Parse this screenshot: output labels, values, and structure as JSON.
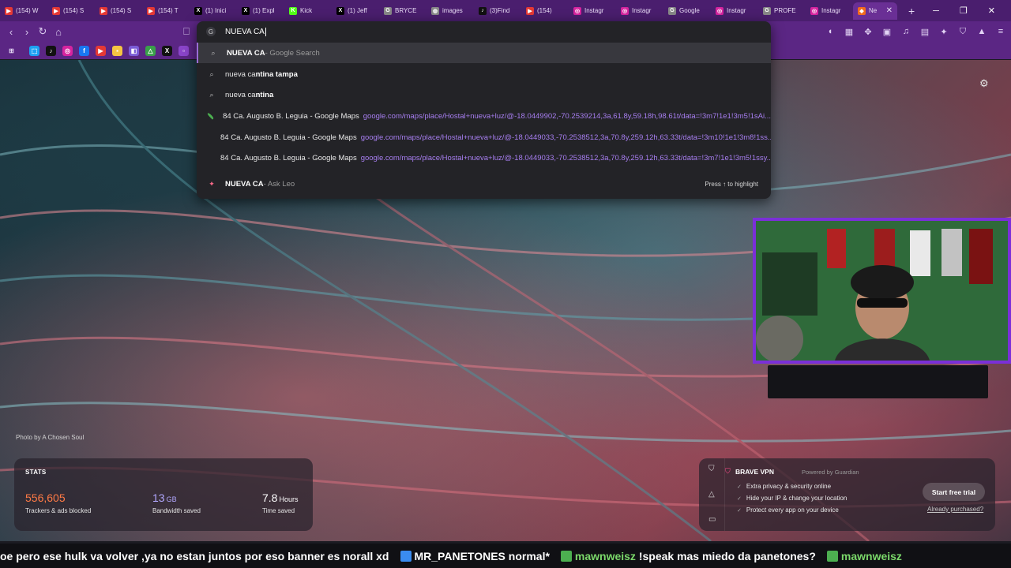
{
  "tabs": [
    {
      "label": "(154) W",
      "icon": "youtube-icon",
      "color": "#e53935"
    },
    {
      "label": "(154) S",
      "icon": "youtube-icon",
      "color": "#e53935"
    },
    {
      "label": "(154) S",
      "icon": "youtube-icon",
      "color": "#e53935"
    },
    {
      "label": "(154) T",
      "icon": "youtube-icon",
      "color": "#e53935"
    },
    {
      "label": "(1) Inici",
      "icon": "x-icon",
      "color": "#000000"
    },
    {
      "label": "(1) Expl",
      "icon": "x-icon",
      "color": "#000000"
    },
    {
      "label": "Kick",
      "icon": "kick-icon",
      "color": "#53fc18"
    },
    {
      "label": "(1) Jeff",
      "icon": "x-icon",
      "color": "#000000"
    },
    {
      "label": "BRYCE",
      "icon": "google-icon",
      "color": "#888888"
    },
    {
      "label": "images",
      "icon": "web-icon",
      "color": "#888888"
    },
    {
      "label": "(3)Find",
      "icon": "tiktok-icon",
      "color": "#111111"
    },
    {
      "label": "(154)",
      "icon": "youtube-icon",
      "color": "#e53935"
    },
    {
      "label": "Instagr",
      "icon": "instagram-icon",
      "color": "#d6249f"
    },
    {
      "label": "Instagr",
      "icon": "instagram-icon",
      "color": "#d6249f"
    },
    {
      "label": "Google",
      "icon": "google-icon",
      "color": "#888888"
    },
    {
      "label": "Instagr",
      "icon": "instagram-icon",
      "color": "#d6249f"
    },
    {
      "label": "PROFE",
      "icon": "google-icon",
      "color": "#888888"
    },
    {
      "label": "Instagr",
      "icon": "instagram-icon",
      "color": "#d6249f"
    }
  ],
  "active_tab": {
    "label": "Ne",
    "icon": "brave-icon"
  },
  "omnibox": {
    "query": "NUEVA CA",
    "suggestions": [
      {
        "type": "search",
        "bold": "NUEVA CA",
        "suffix": " - Google Search"
      },
      {
        "type": "search",
        "prefix": "nueva ca",
        "bold": "ntina tampa"
      },
      {
        "type": "search",
        "prefix": "nueva ca",
        "bold": "ntina"
      },
      {
        "type": "maps",
        "title": "84 Ca. Augusto B. Leguia - Google Maps",
        "url": "google.com/maps/place/Hostal+nueva+luz/@-18.0449902,-70.2539214,3a,61.8y,59.18h,98.61t/data=!3m7!1e1!3m5!1sAi..."
      },
      {
        "type": "maps",
        "title": "84 Ca. Augusto B. Leguia - Google Maps",
        "url": "google.com/maps/place/Hostal+nueva+luz/@-18.0449033,-70.2538512,3a,70.8y,259.12h,63.33t/data=!3m10!1e1!3m8!1ss..."
      },
      {
        "type": "maps",
        "title": "84 Ca. Augusto B. Leguia - Google Maps",
        "url": "google.com/maps/place/Hostal+nueva+luz/@-18.0449033,-70.2538512,3a,70.8y,259.12h,63.33t/data=!3m7!1e1!3m5!1ssy..."
      },
      {
        "type": "leo",
        "bold": "NUEVA CA",
        "suffix": " - Ask Leo",
        "hint": "Press ↑ to highlight"
      }
    ]
  },
  "photo_credit": "Photo by A Chosen Soul",
  "stats": {
    "header": "STATS",
    "trackers_value": "556,605",
    "trackers_label": "Trackers & ads blocked",
    "bandwidth_value": "13",
    "bandwidth_unit": "GB",
    "bandwidth_label": "Bandwidth saved",
    "time_value": "7.8",
    "time_unit": "Hours",
    "time_label": "Time saved",
    "colors": {
      "trackers": "#ff7a45",
      "bandwidth": "#b2a8ff",
      "time": "#ffffff"
    }
  },
  "vpn": {
    "title": "BRAVE VPN",
    "powered": "Powered by",
    "provider": "Guardian",
    "features": [
      "Extra privacy & security online",
      "Hide your IP & change your location",
      "Protect every app on your device"
    ],
    "trial_button": "Start free trial",
    "purchased_link": "Already purchased?"
  },
  "ticker": {
    "text1": "oe pero ese hulk va volver ,ya no estan juntos por eso banner es norall xd",
    "name1": "MR_PANETONES",
    "msg1": "normal*",
    "name2": "mawnweisz",
    "msg2": "!speak mas miedo da panetones?",
    "name3": "mawnweisz"
  }
}
